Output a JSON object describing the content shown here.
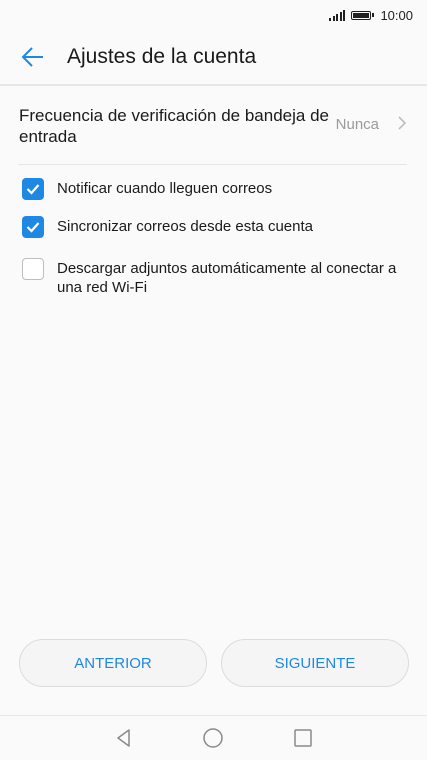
{
  "status_bar": {
    "time": "10:00"
  },
  "app_bar": {
    "title": "Ajustes de la cuenta"
  },
  "inbox_frequency": {
    "title": "Frecuencia de verificación de bandeja de entrada",
    "value": "Nunca"
  },
  "options": [
    {
      "label": "Notificar cuando lleguen correos",
      "checked": true
    },
    {
      "label": "Sincronizar correos desde esta cuenta",
      "checked": true
    },
    {
      "label": "Descargar adjuntos automáticamente al conectar a una red Wi-Fi",
      "checked": false
    }
  ],
  "buttons": {
    "previous": "ANTERIOR",
    "next": "SIGUIENTE"
  },
  "colors": {
    "accent": "#1e88e5",
    "secondary_text": "#9b9b9b",
    "divider": "#e6e6e6"
  }
}
